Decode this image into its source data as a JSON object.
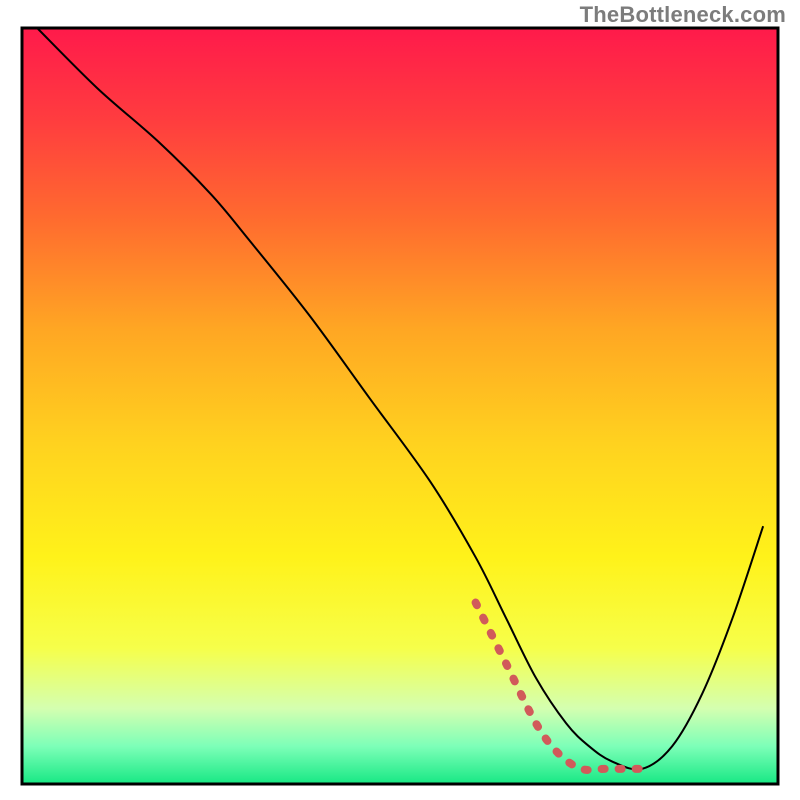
{
  "watermark": "TheBottleneck.com",
  "chart_data": {
    "type": "line",
    "title": "",
    "xlabel": "",
    "ylabel": "",
    "xlim": [
      0,
      100
    ],
    "ylim": [
      0,
      100
    ],
    "grid": false,
    "legend": false,
    "note": "No axis ticks or numeric labels are rendered; x and y values are estimated as percentages of the visible plot area (0 = left/bottom, 100 = right/top). The background is a vertical rainbow gradient with a thin green band at the bottom.",
    "gradient_stops": [
      {
        "pct": 0,
        "color": "#ff1a4b"
      },
      {
        "pct": 12,
        "color": "#ff3c3f"
      },
      {
        "pct": 25,
        "color": "#ff6a2f"
      },
      {
        "pct": 40,
        "color": "#ffa723"
      },
      {
        "pct": 55,
        "color": "#ffd21f"
      },
      {
        "pct": 70,
        "color": "#fff21a"
      },
      {
        "pct": 82,
        "color": "#f6ff4a"
      },
      {
        "pct": 90,
        "color": "#d4ffb0"
      },
      {
        "pct": 95,
        "color": "#7dffb8"
      },
      {
        "pct": 100,
        "color": "#17e884"
      }
    ],
    "series": [
      {
        "name": "black-curve",
        "stroke": "#000000",
        "stroke_width": 2,
        "x": [
          2,
          10,
          18,
          25,
          30,
          38,
          46,
          54,
          60,
          64,
          68,
          72,
          75,
          78,
          82,
          86,
          90,
          94,
          98
        ],
        "y": [
          100,
          92,
          85,
          78,
          72,
          62,
          51,
          40,
          30,
          22,
          14,
          8,
          5,
          3,
          2,
          5,
          12,
          22,
          34
        ]
      },
      {
        "name": "red-dashed-accent",
        "stroke": "#d15a5a",
        "stroke_width": 8,
        "dashed": true,
        "x": [
          60,
          64,
          68,
          71,
          74,
          77,
          80,
          83
        ],
        "y": [
          24,
          16,
          8,
          4,
          2,
          2,
          2,
          2
        ]
      }
    ]
  }
}
